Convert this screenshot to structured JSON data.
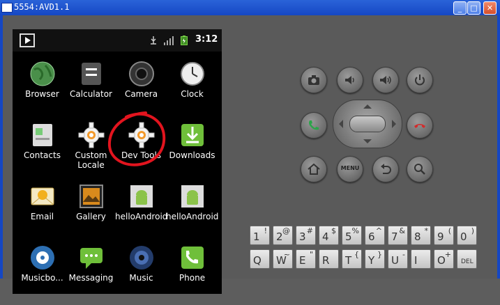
{
  "window": {
    "title": "5554:AVD1.1",
    "minimize": "_",
    "maximize": "□",
    "close": "✕"
  },
  "status": {
    "time": "3:12",
    "icons": [
      "play-store-icon",
      "usb-icon",
      "signal-icon",
      "battery-icon"
    ]
  },
  "apps": [
    {
      "label": "Browser",
      "icon": "globe-icon"
    },
    {
      "label": "Calculator",
      "icon": "calculator-icon"
    },
    {
      "label": "Camera",
      "icon": "camera-icon"
    },
    {
      "label": "Clock",
      "icon": "clock-icon"
    },
    {
      "label": "Contacts",
      "icon": "contacts-icon"
    },
    {
      "label": "Custom\nLocale",
      "icon": "gear-icon"
    },
    {
      "label": "Dev Tools",
      "icon": "gear-icon"
    },
    {
      "label": "Downloads",
      "icon": "download-icon"
    },
    {
      "label": "Email",
      "icon": "email-icon"
    },
    {
      "label": "Gallery",
      "icon": "gallery-icon"
    },
    {
      "label": "helloAndroid",
      "icon": "android-icon"
    },
    {
      "label": "helloAndroid",
      "icon": "android-icon"
    },
    {
      "label": "Musicbo...",
      "icon": "music-icon"
    },
    {
      "label": "Messaging",
      "icon": "message-icon"
    },
    {
      "label": "Music",
      "icon": "speaker-icon"
    },
    {
      "label": "Phone",
      "icon": "phone-icon"
    }
  ],
  "controls": {
    "menu_label": "MENU"
  },
  "keyboard": {
    "row1": [
      {
        "main": "1",
        "alt": "!"
      },
      {
        "main": "2",
        "alt": "@"
      },
      {
        "main": "3",
        "alt": "#"
      },
      {
        "main": "4",
        "alt": "$"
      },
      {
        "main": "5",
        "alt": "%"
      },
      {
        "main": "6",
        "alt": "^"
      },
      {
        "main": "7",
        "alt": "&"
      },
      {
        "main": "8",
        "alt": "*"
      },
      {
        "main": "9",
        "alt": "("
      },
      {
        "main": "0",
        "alt": ")"
      }
    ],
    "row2": [
      {
        "main": "Q",
        "alt": ""
      },
      {
        "main": "W",
        "alt": "~"
      },
      {
        "main": "E",
        "alt": "\""
      },
      {
        "main": "R",
        "alt": ""
      },
      {
        "main": "T",
        "alt": "{"
      },
      {
        "main": "Y",
        "alt": "}"
      },
      {
        "main": "U",
        "alt": "-"
      },
      {
        "main": "I",
        "alt": ""
      },
      {
        "main": "O",
        "alt": "+"
      },
      {
        "main": "DEL",
        "alt": ""
      }
    ]
  },
  "colors": {
    "annotation": "#e2141e",
    "title_bar": "#1547c4",
    "call_green": "#2ca44a",
    "end_red": "#d32a2a"
  }
}
